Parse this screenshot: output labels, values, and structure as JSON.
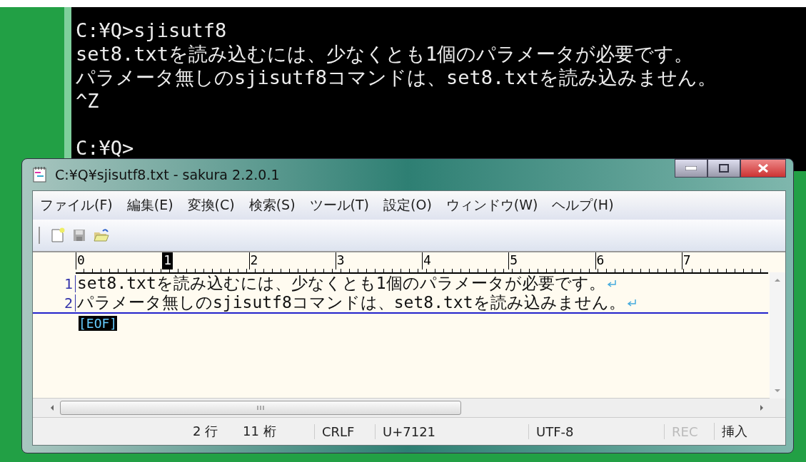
{
  "console": {
    "lines": [
      "C:¥Q>sjisutf8",
      "set8.txtを読み込むには、少なくとも1個のパラメータが必要です。",
      "パラメータ無しのsjisutf8コマンドは、set8.txtを読み込みません。",
      "^Z",
      "C:¥Q>"
    ]
  },
  "window": {
    "title": "C:¥Q¥sjisutf8.txt - sakura 2.2.0.1"
  },
  "menu": [
    "ファイル(F)",
    "編集(E)",
    "変換(C)",
    "検索(S)",
    "ツール(T)",
    "設定(O)",
    "ウィンドウ(W)",
    "ヘルプ(H)"
  ],
  "ruler": [
    {
      "label": "0",
      "selected": false
    },
    {
      "label": "1",
      "selected": true
    },
    {
      "label": "2",
      "selected": false
    },
    {
      "label": "3",
      "selected": false
    },
    {
      "label": "4",
      "selected": false
    },
    {
      "label": "5",
      "selected": false
    },
    {
      "label": "6",
      "selected": false
    },
    {
      "label": "7",
      "selected": false
    }
  ],
  "lines": [
    {
      "number": "1",
      "text": "set8.txtを読み込むには、少なくとも1個のパラメータが必要です。",
      "current": false
    },
    {
      "number": "2",
      "text": "パラメータ無しのsjisutf8コマンドは、set8.txtを読み込みません。",
      "current": true
    }
  ],
  "eof": "[EOF]",
  "status_bar": [
    {
      "text": "2 行",
      "disabled": false
    },
    {
      "text": "11 桁",
      "disabled": false
    },
    {
      "text": "CRLF",
      "disabled": false
    },
    {
      "text": "U+7121",
      "disabled": false
    },
    {
      "text": "UTF-8",
      "disabled": false
    },
    {
      "text": "REC",
      "disabled": true
    },
    {
      "text": "挿入",
      "disabled": false
    }
  ]
}
